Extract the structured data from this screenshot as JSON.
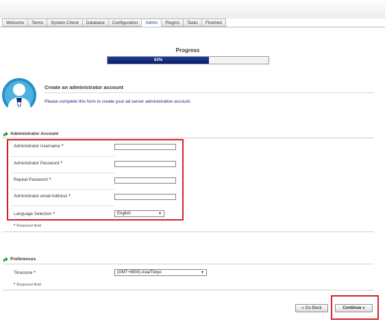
{
  "tabs": [
    "Welcome",
    "Terms",
    "System Check",
    "Database",
    "Configuration",
    "Admin",
    "Plugins",
    "Tasks",
    "Finished"
  ],
  "active_tab": "Admin",
  "progress": {
    "title": "Progress",
    "label": "63%",
    "value": 0.63
  },
  "intro": {
    "title": "Create an administrator account",
    "text": "Please complete this form to create your ad server administration account."
  },
  "admin_section": {
    "title": "Administrator Account",
    "fields": {
      "username_label": "Administrator Username",
      "password_label": "Administrator Password",
      "repeat_password_label": "Repeat Password",
      "email_label": "Administrator email Address",
      "language_label": "Language Selection",
      "language_value": "English"
    },
    "required_marker": "*",
    "required_note": "Required field"
  },
  "preferences_section": {
    "title": "Preferences",
    "timezone_label": "Timezone",
    "timezone_value": "(GMT+0900) Asia/Tokyo",
    "required_note": "Required field"
  },
  "buttons": {
    "back": "« Go Back",
    "continue": "Continue »"
  },
  "colors": {
    "progress_fill": "#0b1e66",
    "highlight": "#d42028",
    "required": "#c00000",
    "link_text": "#1a2a7a"
  },
  "icons": {
    "admin": "administrator-user-icon",
    "section": "green-arrow-icon"
  }
}
